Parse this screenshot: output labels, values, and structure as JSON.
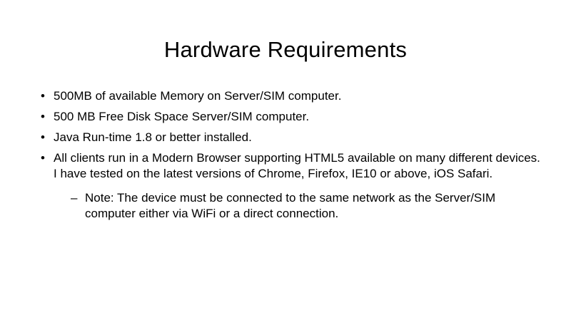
{
  "slide": {
    "title": "Hardware Requirements",
    "bullets": [
      "500MB of available Memory on Server/SIM computer.",
      "500 MB Free Disk Space Server/SIM computer.",
      "Java Run-time 1.8 or better installed.",
      "All clients run in a Modern Browser supporting HTML5 available on many different devices. I have tested on the latest versions of Chrome, Firefox, IE10 or above, iOS Safari."
    ],
    "sub_bullets": [
      "Note: The device must be connected to the same network as the Server/SIM computer either via WiFi or a direct connection."
    ],
    "bullet_glyph": "•",
    "sub_bullet_glyph": "–"
  }
}
